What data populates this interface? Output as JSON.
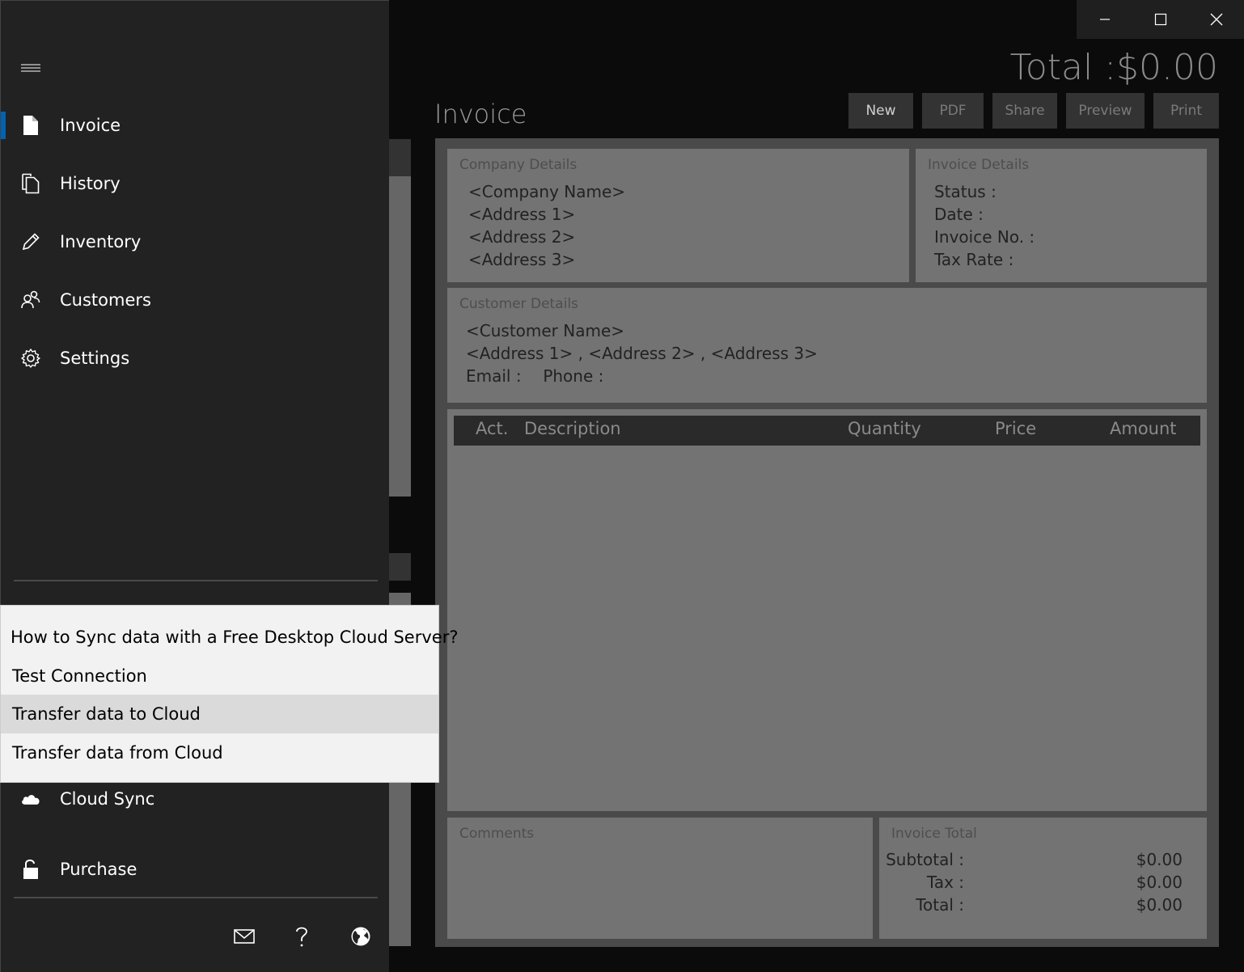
{
  "window": {
    "controls": {
      "minimize": "minimize-icon",
      "maximize": "maximize-icon",
      "close": "close-icon"
    }
  },
  "header": {
    "grand_total": "Total :$0.00",
    "page_title": "Invoice"
  },
  "toolbar": {
    "new_label": "New",
    "pdf_label": "PDF",
    "share_label": "Share",
    "preview_label": "Preview",
    "print_label": "Print"
  },
  "company": {
    "title": "Company Details",
    "name": "<Company Name>",
    "address1": "<Address 1>",
    "address2": "<Address 2>",
    "address3": "<Address 3>"
  },
  "invoice_details": {
    "title": "Invoice Details",
    "status": "Status :",
    "date": "Date :",
    "invoice_no": "Invoice No. :",
    "tax_rate": "Tax Rate :"
  },
  "customer": {
    "title": "Customer Details",
    "name": "<Customer Name>",
    "address_line": "<Address 1> , <Address 2> , <Address 3>",
    "email": "Email :",
    "phone": "Phone :"
  },
  "items": {
    "columns": [
      "Act.",
      "Description",
      "Quantity",
      "Price",
      "Amount"
    ]
  },
  "comments": {
    "title": "Comments"
  },
  "invoice_total": {
    "title": "Invoice Total",
    "subtotal_label": "Subtotal :",
    "subtotal_value": "$0.00",
    "tax_label": "Tax :",
    "tax_value": "$0.00",
    "total_label": "Total :",
    "total_value": "$0.00"
  },
  "sidebar": {
    "items": [
      {
        "label": "Invoice",
        "icon": "document-icon",
        "selected": true
      },
      {
        "label": "History",
        "icon": "copy-icon"
      },
      {
        "label": "Inventory",
        "icon": "pencil-icon"
      },
      {
        "label": "Customers",
        "icon": "people-icon"
      },
      {
        "label": "Settings",
        "icon": "gear-icon"
      }
    ],
    "cloud_sync": {
      "label": "Cloud Sync",
      "icon": "cloud-icon"
    },
    "purchase": {
      "label": "Purchase",
      "icon": "unlock-icon"
    },
    "footer": [
      "mail-icon",
      "help-icon",
      "globe-icon"
    ],
    "accent": "#0063b1"
  },
  "flyout": {
    "items": [
      "How to Sync data with a Free Desktop Cloud Server?",
      "Test Connection",
      "Transfer data to Cloud",
      "Transfer data from Cloud"
    ]
  }
}
